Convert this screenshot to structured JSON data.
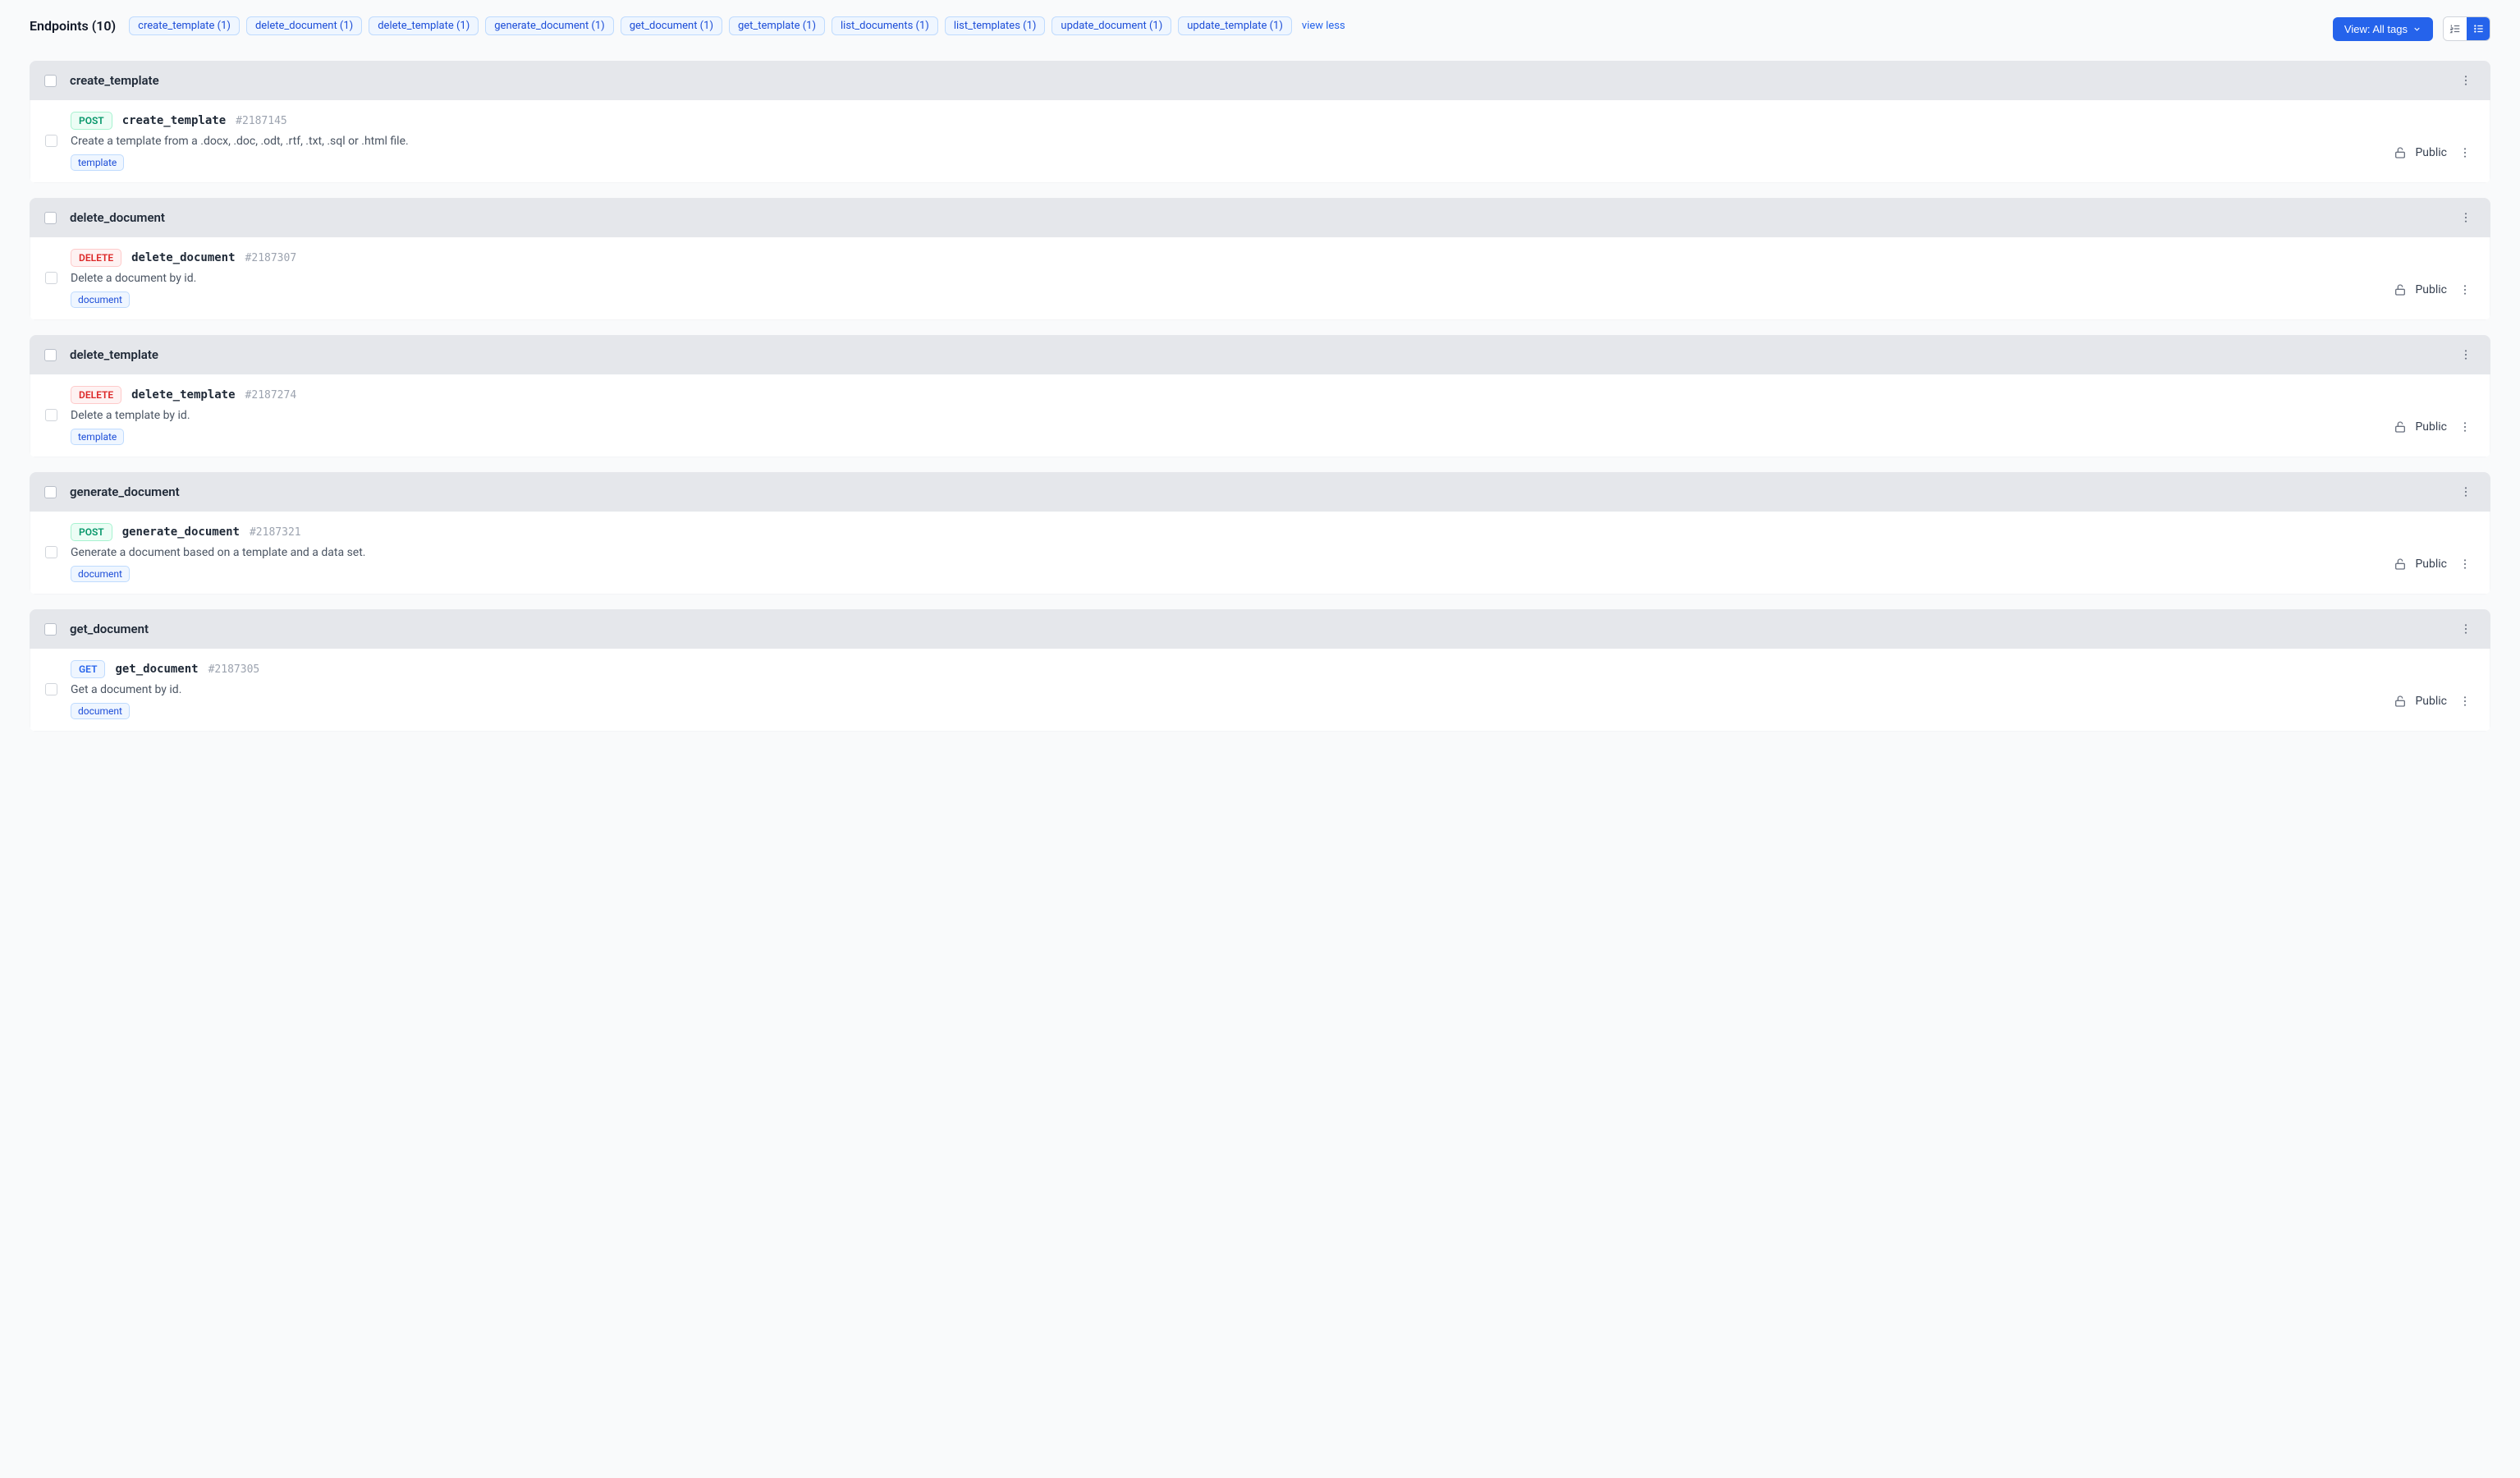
{
  "header": {
    "title": "Endpoints (10)",
    "view_button": "View: All tags",
    "view_less": "view less",
    "tags": [
      "create_template (1)",
      "delete_document (1)",
      "delete_template (1)",
      "generate_document (1)",
      "get_document (1)",
      "get_template (1)",
      "list_documents (1)",
      "list_templates (1)",
      "update_document (1)",
      "update_template (1)"
    ]
  },
  "visibility_label": "Public",
  "groups": [
    {
      "title": "create_template",
      "method": "POST",
      "name": "create_template",
      "id": "#2187145",
      "desc": "Create a template from a .docx, .doc, .odt, .rtf, .txt, .sql or .html file.",
      "tag": "template"
    },
    {
      "title": "delete_document",
      "method": "DELETE",
      "name": "delete_document",
      "id": "#2187307",
      "desc": "Delete a document by id.",
      "tag": "document"
    },
    {
      "title": "delete_template",
      "method": "DELETE",
      "name": "delete_template",
      "id": "#2187274",
      "desc": "Delete a template by id.",
      "tag": "template"
    },
    {
      "title": "generate_document",
      "method": "POST",
      "name": "generate_document",
      "id": "#2187321",
      "desc": "Generate a document based on a template and a data set.",
      "tag": "document"
    },
    {
      "title": "get_document",
      "method": "GET",
      "name": "get_document",
      "id": "#2187305",
      "desc": "Get a document by id.",
      "tag": "document"
    }
  ]
}
